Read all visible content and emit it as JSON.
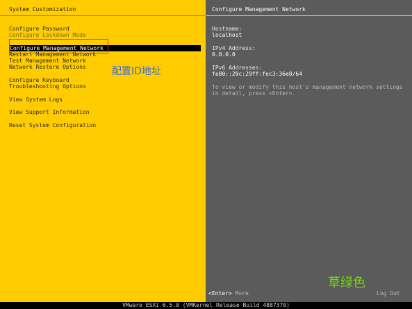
{
  "left_panel": {
    "title": "System Customization",
    "menu": [
      {
        "label": "Configure Password"
      },
      {
        "label": "Configure Lockdown Mode"
      },
      {
        "label": "Configure Management Network"
      },
      {
        "label": "Restart Management Network"
      },
      {
        "label": "Test Management Network"
      },
      {
        "label": "Network Restore Options"
      },
      {
        "label": "Configure Keyboard"
      },
      {
        "label": "Troubleshooting Options"
      },
      {
        "label": "View System Logs"
      },
      {
        "label": "View Support Information"
      },
      {
        "label": "Reset System Configuration"
      }
    ],
    "annotation": "配置ID地址"
  },
  "right_panel": {
    "title": "Configure Management Network",
    "hostname_label": "Hostname:",
    "hostname_value": "localhost",
    "ipv4_label": "IPv4 Address:",
    "ipv4_value": "0.0.0.0",
    "ipv6_label": "IPv6 Addresses:",
    "ipv6_value": "fe80::20c:29ff:fec3:36e8/64",
    "help_text": "To view or modify this host's management network settings in detail, press <Enter>.",
    "footer_key": "<Enter>",
    "footer_action": "More",
    "footer_right": "Log Out",
    "annotation": "草绿色"
  },
  "statusbar": {
    "text": "VMware ESXi 6.5.0 (VMKernel Release Build 4887370)"
  },
  "colors": {
    "left_bg": "#ffcc00",
    "right_bg": "#5b5b5b",
    "highlight_border": "#e8302a",
    "annotation_blue": "#3d6bd6",
    "annotation_green": "#7ed321"
  }
}
